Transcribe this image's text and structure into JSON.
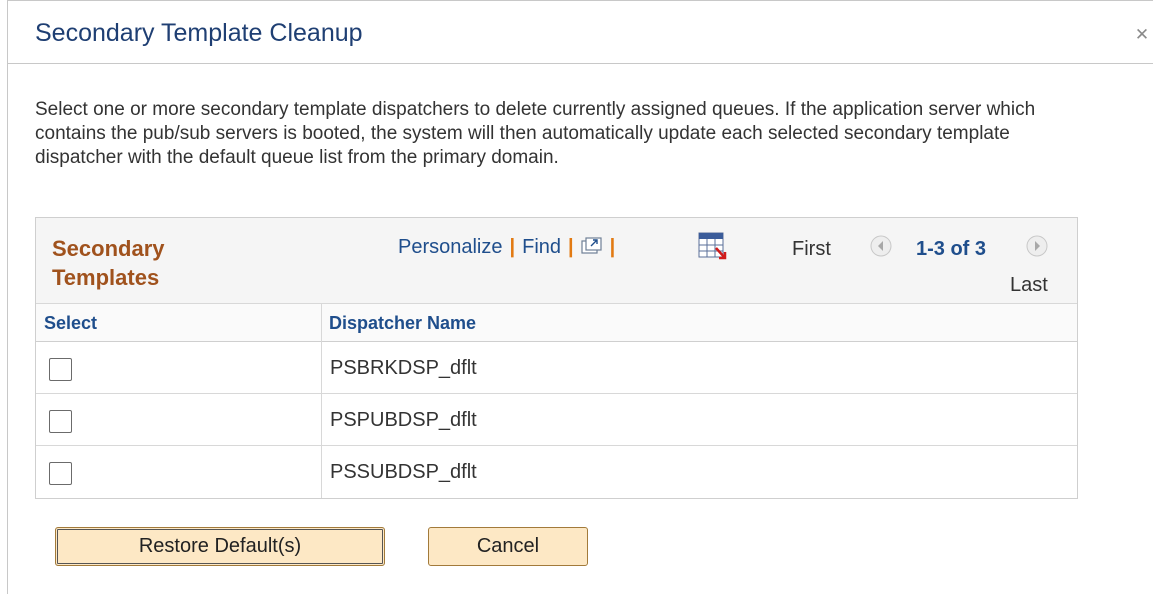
{
  "dialog": {
    "title": "Secondary Template Cleanup",
    "close_icon": "close-icon",
    "instructions": "Select one or more secondary template dispatchers to delete currently assigned queues.  If the application server which contains the pub/sub servers is booted, the system will then automatically update each selected secondary template dispatcher with the default queue list from the primary domain."
  },
  "grid": {
    "title": "Secondary Templates",
    "personalize": "Personalize",
    "find": "Find",
    "view_all_icon": "zoom-new-window-icon",
    "download_icon": "download-to-excel-icon",
    "pager": {
      "first": "First",
      "range": "1-3 of 3",
      "last": "Last",
      "prev_icon": "previous-arrow-icon",
      "next_icon": "next-arrow-icon"
    },
    "columns": {
      "select": "Select",
      "dispatcher_name": "Dispatcher Name"
    },
    "rows": [
      {
        "selected": false,
        "name": "PSBRKDSP_dflt"
      },
      {
        "selected": false,
        "name": "PSPUBDSP_dflt"
      },
      {
        "selected": false,
        "name": "PSSUBDSP_dflt"
      }
    ]
  },
  "buttons": {
    "restore": "Restore Default(s)",
    "cancel": "Cancel"
  },
  "colors": {
    "title": "#1f3f73",
    "grid_title": "#a0521d",
    "link": "#1f4e8c",
    "separator": "#e27a12",
    "button_bg": "#fde8c5"
  }
}
